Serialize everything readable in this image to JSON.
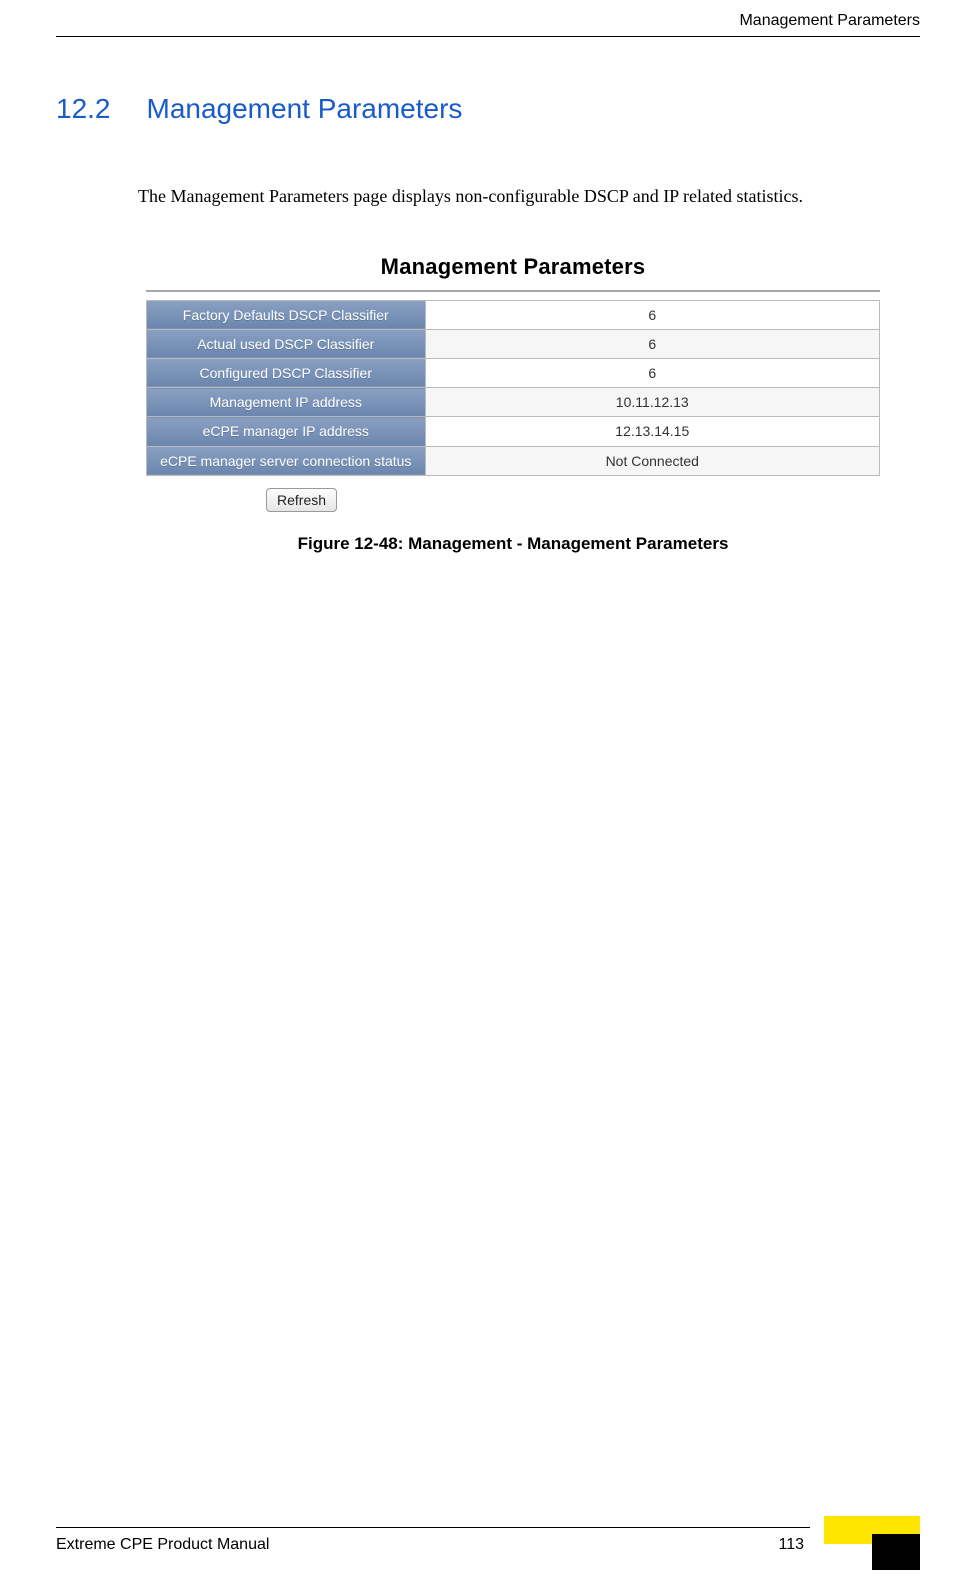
{
  "header": {
    "running_title": "Management Parameters"
  },
  "section": {
    "number": "12.2",
    "title": "Management Parameters"
  },
  "body": {
    "paragraph": "The Management Parameters page displays non-configurable DSCP and IP related statistics."
  },
  "figure": {
    "panel_title": "Management Parameters",
    "rows": [
      {
        "label": "Factory Defaults DSCP Classifier",
        "value": "6"
      },
      {
        "label": "Actual used DSCP Classifier",
        "value": "6"
      },
      {
        "label": "Configured DSCP Classifier",
        "value": "6"
      },
      {
        "label": "Management IP address",
        "value": "10.11.12.13"
      },
      {
        "label": "eCPE manager IP address",
        "value": "12.13.14.15"
      },
      {
        "label": "eCPE manager server connection status",
        "value": "Not Connected"
      }
    ],
    "refresh_label": "Refresh",
    "caption": "Figure 12-48: Management - Management Parameters"
  },
  "footer": {
    "manual_title": "Extreme CPE Product Manual",
    "page_number": "113"
  }
}
